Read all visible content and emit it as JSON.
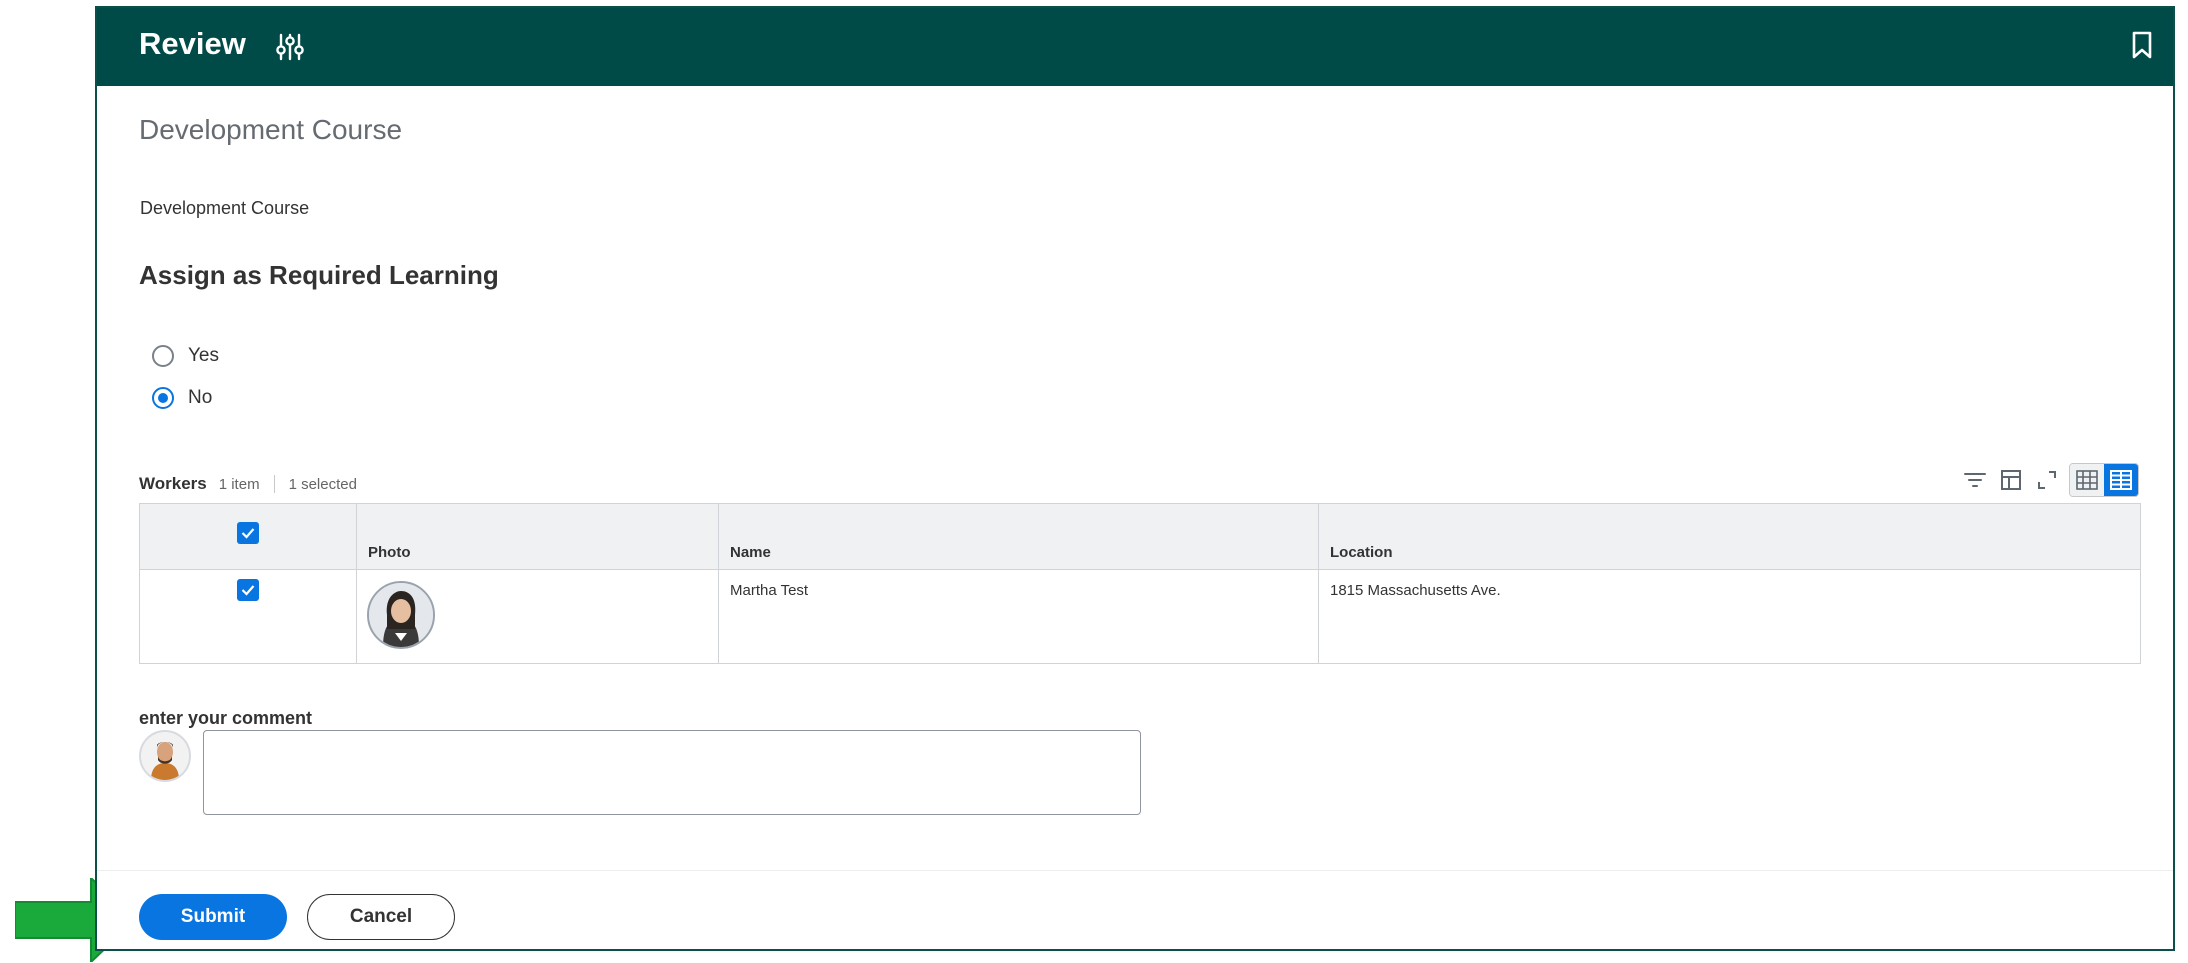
{
  "header": {
    "title": "Review",
    "related_actions_icon": "sliders-icon",
    "bookmark_icon": "bookmark-icon"
  },
  "section": {
    "title": "Development Course",
    "course_text": "Development Course"
  },
  "assign": {
    "title": "Assign as Required Learning",
    "options": [
      {
        "label": "Yes",
        "selected": false
      },
      {
        "label": "No",
        "selected": true
      }
    ]
  },
  "workers": {
    "label": "Workers",
    "count": "1 item",
    "selected": "1 selected",
    "columns": [
      "Photo",
      "Name",
      "Location"
    ],
    "rows": [
      {
        "checked": true,
        "name": "Martha Test",
        "location": "1815 Massachusetts Ave."
      }
    ]
  },
  "comment": {
    "label": "enter your comment",
    "value": "",
    "placeholder": ""
  },
  "actions": {
    "submit": "Submit",
    "cancel": "Cancel"
  },
  "colors": {
    "header_bg": "#004b47",
    "accent": "#0875e1",
    "arrow": "#1aaa3c"
  }
}
